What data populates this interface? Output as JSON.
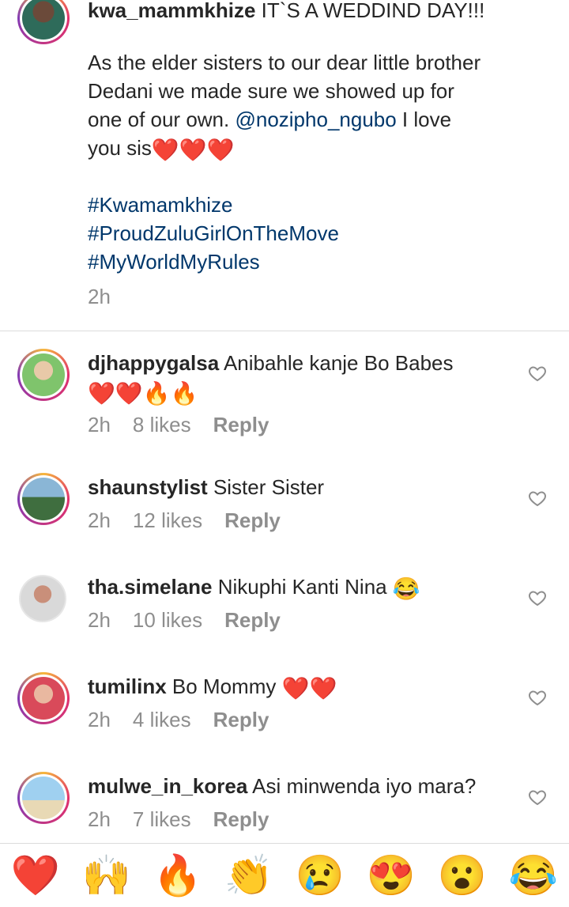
{
  "post": {
    "username": "kwa_mammkhize",
    "title_line": " IT`S A WEDDIND DAY!!!",
    "body_line1": "As the elder sisters to our dear little brother",
    "body_line2": "Dedani we made sure we showed up for",
    "body_line3_pre": "one of our own. ",
    "mention": "@nozipho_ngubo",
    "body_line3_post": " I love",
    "body_line4": "you sis",
    "body_emojis": "❤️❤️❤️",
    "hashtags": [
      "#Kwamamkhize",
      "#ProudZuluGirlOnTheMove",
      "#MyWorldMyRules"
    ],
    "time": "2h"
  },
  "comments": [
    {
      "username": "djhappygalsa",
      "text": " Anibahle kanje Bo Babes",
      "emojis": "❤️❤️🔥🔥",
      "time": "2h",
      "likes": "8 likes",
      "reply": "Reply"
    },
    {
      "username": "shaunstylist",
      "text": " Sister Sister",
      "emojis": "",
      "time": "2h",
      "likes": "12 likes",
      "reply": "Reply"
    },
    {
      "username": "tha.simelane",
      "text": " Nikuphi Kanti Nina ",
      "emojis": "😂",
      "time": "2h",
      "likes": "10 likes",
      "reply": "Reply"
    },
    {
      "username": "tumilinx",
      "text": " Bo Mommy ",
      "emojis": "❤️❤️",
      "time": "2h",
      "likes": "4 likes",
      "reply": "Reply"
    },
    {
      "username": "mulwe_in_korea",
      "text": " Asi minwenda iyo mara?",
      "emojis": "",
      "time": "2h",
      "likes": "7 likes",
      "reply": "Reply"
    }
  ],
  "reactions": [
    "❤️",
    "🙌",
    "🔥",
    "👏",
    "😢",
    "😍",
    "😮",
    "😂"
  ],
  "icons": {
    "like": "heart-outline-icon"
  },
  "colors": {
    "link": "#00376b",
    "meta": "#8e8e8e",
    "ring": "#e1306c"
  }
}
